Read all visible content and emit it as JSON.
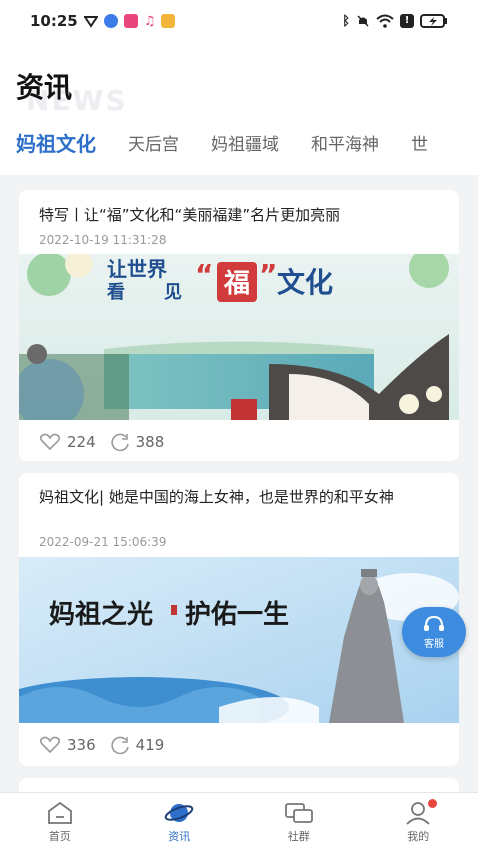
{
  "status": {
    "time": "10:25"
  },
  "header": {
    "title": "资讯",
    "ghost": "NEWS"
  },
  "tabs": [
    {
      "label": "妈祖文化"
    },
    {
      "label": "天后宫"
    },
    {
      "label": "妈祖疆域"
    },
    {
      "label": "和平海神"
    },
    {
      "label": "世"
    }
  ],
  "articles": [
    {
      "title": "特写丨让“福”文化和“美丽福建”名片更加亮丽",
      "date": "2022-10-19 11:31:28",
      "image_text": {
        "line1": "让世界",
        "line2": "看",
        "line3": "见",
        "quote_open": "“",
        "fu": "福",
        "quote_close": "”",
        "culture": "文化"
      },
      "likes": "224",
      "shares": "388"
    },
    {
      "title": "妈祖文化| 她是中国的海上女神，也是世界的和平女神",
      "date": "2022-09-21 15:06:39",
      "image_text": {
        "slogan_a": "妈祖之光",
        "slogan_b": "护佑一生"
      },
      "likes": "336",
      "shares": "419"
    }
  ],
  "fab": {
    "label": "客服"
  },
  "nav": [
    {
      "label": "首页",
      "icon": "home-icon"
    },
    {
      "label": "资讯",
      "icon": "planet-icon"
    },
    {
      "label": "社群",
      "icon": "chat-icon"
    },
    {
      "label": "我的",
      "icon": "user-icon"
    }
  ],
  "colors": {
    "accent": "#2e6fc9",
    "fab": "#3d8ce0",
    "badge": "#e8463c"
  }
}
